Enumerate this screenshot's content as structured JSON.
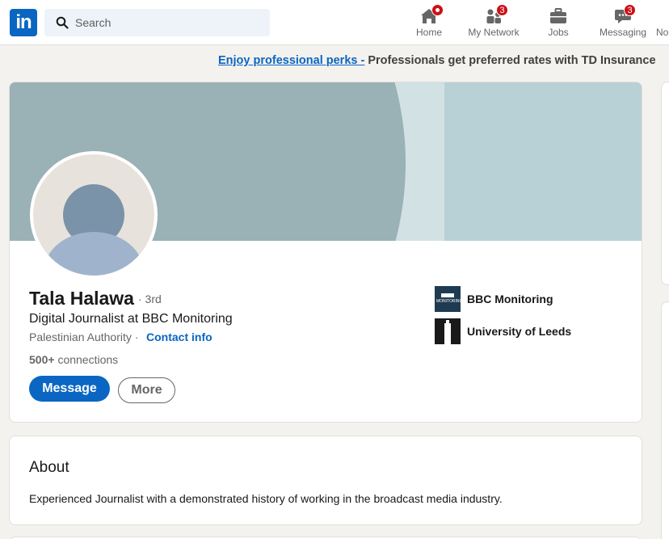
{
  "nav": {
    "logo_text": "in",
    "search_placeholder": "Search",
    "items": [
      {
        "label": "Home",
        "icon": "home-icon",
        "badge": ""
      },
      {
        "label": "My Network",
        "icon": "people-icon",
        "badge": "3"
      },
      {
        "label": "Jobs",
        "icon": "briefcase-icon",
        "badge": ""
      },
      {
        "label": "Messaging",
        "icon": "chat-icon",
        "badge": "3"
      },
      {
        "label": "No",
        "icon": "bell-icon",
        "badge": ""
      }
    ]
  },
  "promo": {
    "link": "Enjoy professional perks -",
    "text": "Professionals get preferred rates with TD Insurance"
  },
  "profile": {
    "name": "Tala Halawa",
    "degree": "· 3rd",
    "headline": "Digital Journalist at BBC Monitoring",
    "location": "Palestinian Authority ·",
    "contact_info": "Contact info",
    "connections_count": "500+",
    "connections_label": "connections",
    "message_button": "Message",
    "more_button": "More",
    "organizations": [
      {
        "name": "BBC Monitoring",
        "logo_text": "MONITORING"
      },
      {
        "name": "University of Leeds"
      }
    ]
  },
  "about": {
    "title": "About",
    "text": "Experienced Journalist with a demonstrated history of working in the broadcast media industry."
  },
  "colors": {
    "brand": "#0a66c2",
    "badge": "#cc1016",
    "background": "#f4f2ee"
  }
}
